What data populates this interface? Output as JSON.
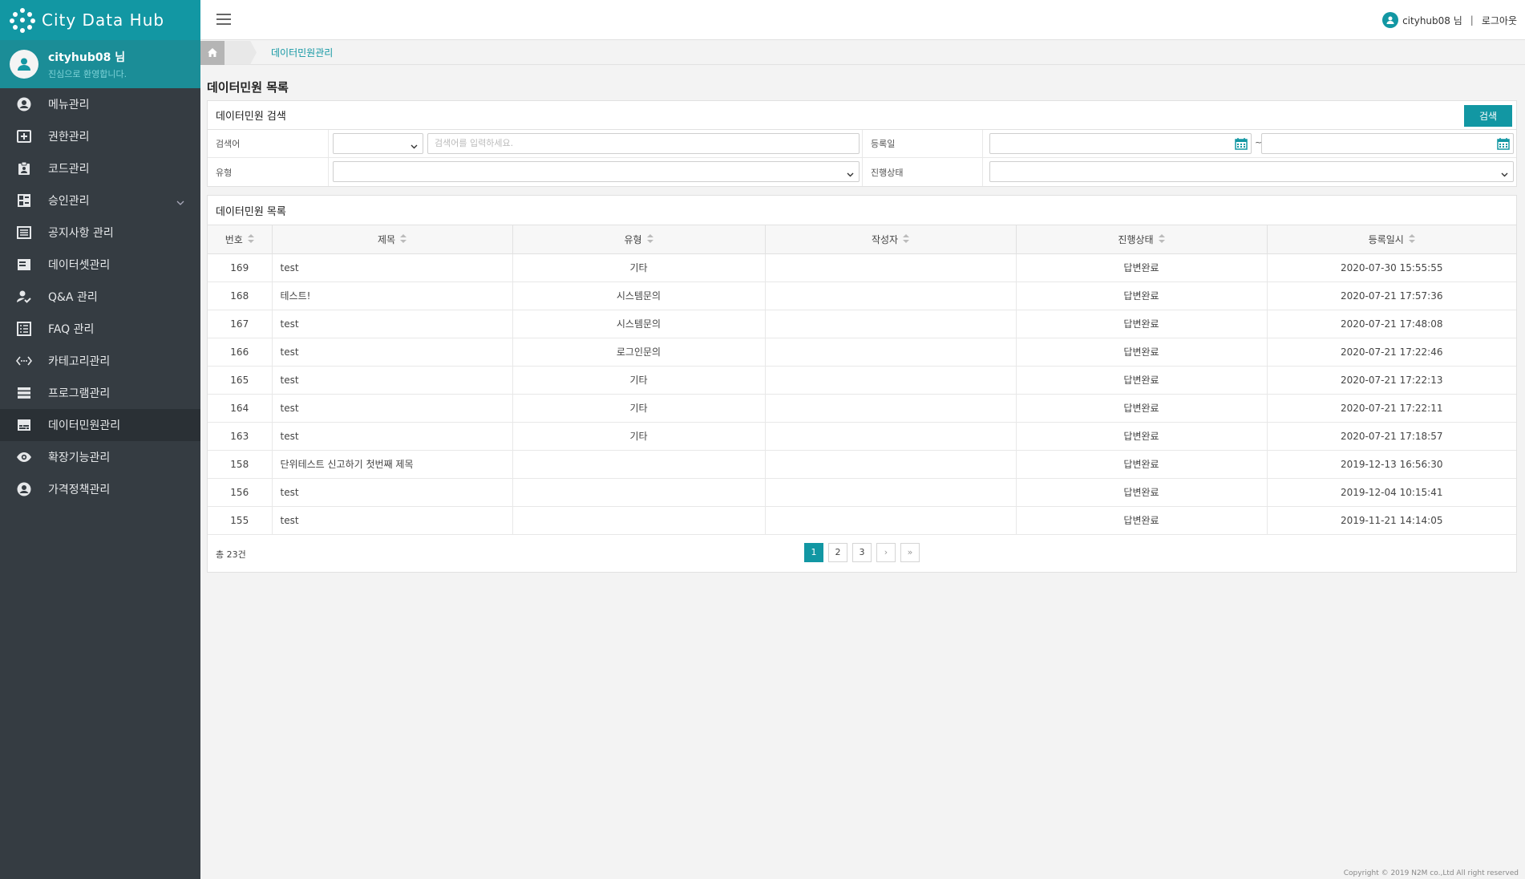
{
  "app": {
    "title": "City Data Hub"
  },
  "user": {
    "name": "cityhub08 님",
    "welcome": "진심으로 환영합니다."
  },
  "sidebar": {
    "items": [
      {
        "label": "메뉴관리",
        "icon": "user-circle-icon"
      },
      {
        "label": "권한관리",
        "icon": "add-box-icon"
      },
      {
        "label": "코드관리",
        "icon": "clipboard-icon"
      },
      {
        "label": "승인관리",
        "icon": "dashboard-icon"
      },
      {
        "label": "공지사항 관리",
        "icon": "list-alt-icon"
      },
      {
        "label": "데이터셋관리",
        "icon": "dataset-icon"
      },
      {
        "label": "Q&A 관리",
        "icon": "person-check-icon"
      },
      {
        "label": "FAQ 관리",
        "icon": "list-box-icon"
      },
      {
        "label": "카테고리관리",
        "icon": "code-dots-icon"
      },
      {
        "label": "프로그램관리",
        "icon": "storage-icon"
      },
      {
        "label": "데이터민원관리",
        "icon": "subtitles-icon"
      },
      {
        "label": "확장기능관리",
        "icon": "eye-icon"
      },
      {
        "label": "가격정책관리",
        "icon": "user-circle-icon"
      }
    ]
  },
  "topbar": {
    "user": "cityhub08 님",
    "separator": "|",
    "logout": "로그아웃"
  },
  "breadcrumb": {
    "current": "데이터민원관리"
  },
  "page_title": "데이터민원 목록",
  "search": {
    "title": "데이터민원 검색",
    "button": "검색",
    "keyword_label": "검색어",
    "keyword_placeholder": "검색어를 입력하세요.",
    "date_label": "등록일",
    "date_sep": "~",
    "type_label": "유형",
    "status_label": "진행상태"
  },
  "list": {
    "title": "데이터민원 목록",
    "columns": [
      "번호",
      "제목",
      "유형",
      "작성자",
      "진행상태",
      "등록일시"
    ],
    "rows": [
      [
        "169",
        "test",
        "기타",
        "",
        "답변완료",
        "2020-07-30 15:55:55"
      ],
      [
        "168",
        "테스트!",
        "시스템문의",
        "",
        "답변완료",
        "2020-07-21 17:57:36"
      ],
      [
        "167",
        "test",
        "시스템문의",
        "",
        "답변완료",
        "2020-07-21 17:48:08"
      ],
      [
        "166",
        "test",
        "로그인문의",
        "",
        "답변완료",
        "2020-07-21 17:22:46"
      ],
      [
        "165",
        "test",
        "기타",
        "",
        "답변완료",
        "2020-07-21 17:22:13"
      ],
      [
        "164",
        "test",
        "기타",
        "",
        "답변완료",
        "2020-07-21 17:22:11"
      ],
      [
        "163",
        "test",
        "기타",
        "",
        "답변완료",
        "2020-07-21 17:18:57"
      ],
      [
        "158",
        "단위테스트 신고하기 첫번째 제목",
        "",
        "",
        "답변완료",
        "2019-12-13 16:56:30"
      ],
      [
        "156",
        "test",
        "",
        "",
        "답변완료",
        "2019-12-04 10:15:41"
      ],
      [
        "155",
        "test",
        "",
        "",
        "답변완료",
        "2019-11-21 14:14:05"
      ]
    ],
    "total": "총 23건",
    "pages": [
      "1",
      "2",
      "3"
    ],
    "next": "›",
    "last": "»"
  },
  "copyright": "Copyright © 2019 N2M co.,Ltd All right reserved",
  "colors": {
    "accent": "#1297a3",
    "sidebar": "#353c42"
  }
}
